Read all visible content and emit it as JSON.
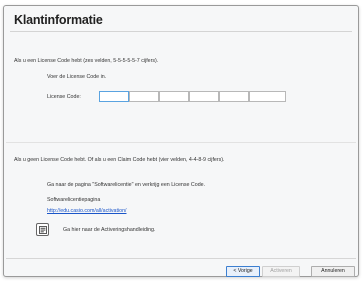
{
  "dialog": {
    "title": "Klantinformatie"
  },
  "license_section": {
    "intro": "Als u een License Code hebt (zes velden, 5-5-5-5-5-7 cijfers).",
    "instruction": "Voer de License Code in.",
    "field_label": "License Code:",
    "fields": [
      "",
      "",
      "",
      "",
      "",
      ""
    ]
  },
  "claim_section": {
    "intro": "Als u geen License Code hebt. Of als u een Claim Code hebt (vier velden, 4-4-8-9 cijfers).",
    "instruction": "Ga naar de pagina \"Softwarelicentie\" en verkrijg een License Code.",
    "page_label": "Softwarelicentiepagina",
    "link": "http://edu.casio.com/all/activation/"
  },
  "manual": {
    "icon": "document-icon",
    "label": "Ga hier naar de Activeringshandleiding."
  },
  "buttons": {
    "back": "< Vorige",
    "activate": "Activeren",
    "cancel": "Annuleren"
  }
}
